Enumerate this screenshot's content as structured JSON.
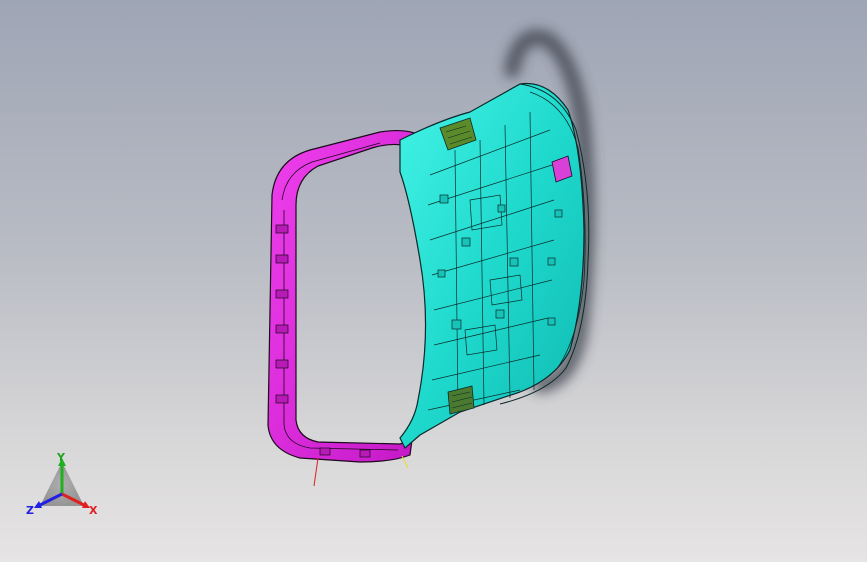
{
  "viewport": {
    "background_top": "#9ea5b5",
    "background_bottom": "#e6e4e4"
  },
  "model": {
    "panel_color": "#2de8d8",
    "frame_color": "#e228e0",
    "clip_color": "#5a8a2a",
    "bracket_color": "#d840d8",
    "edge_color": "#0a2a2a"
  },
  "triad": {
    "x_label": "X",
    "y_label": "Y",
    "z_label": "Z",
    "x_color": "#e02020",
    "y_color": "#20b020",
    "z_color": "#2020e0"
  }
}
